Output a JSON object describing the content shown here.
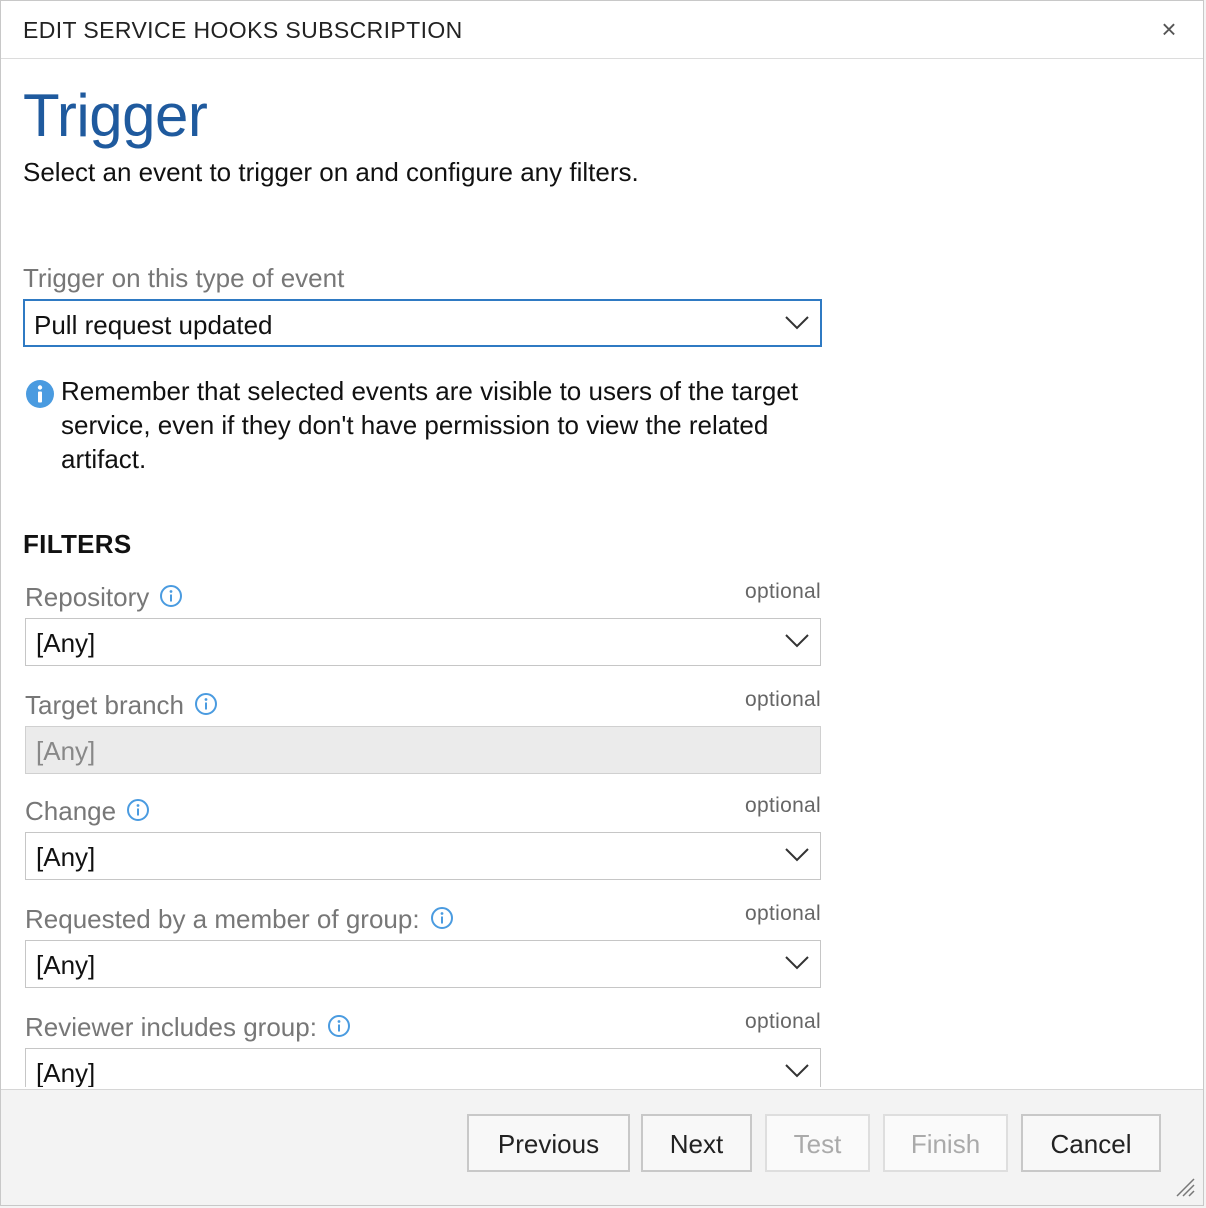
{
  "dialog": {
    "title": "EDIT SERVICE HOOKS SUBSCRIPTION",
    "close_icon": "close-icon"
  },
  "page": {
    "title": "Trigger",
    "subtitle": "Select an event to trigger on and configure any filters."
  },
  "event": {
    "label": "Trigger on this type of event",
    "selected": "Pull request updated"
  },
  "notice": {
    "icon": "info-icon",
    "text": "Remember that selected events are visible to users of the target service, even if they don't have permission to view the related artifact."
  },
  "filters": {
    "heading": "FILTERS",
    "optional_label": "optional",
    "items": [
      {
        "label": "Repository",
        "value": "[Any]",
        "disabled": false
      },
      {
        "label": "Target branch",
        "value": "[Any]",
        "disabled": true
      },
      {
        "label": "Change",
        "value": "[Any]",
        "disabled": false
      },
      {
        "label": "Requested by a member of group:",
        "value": "[Any]",
        "disabled": false
      },
      {
        "label": "Reviewer includes group:",
        "value": "[Any]",
        "disabled": false
      }
    ]
  },
  "footer": {
    "previous": "Previous",
    "next": "Next",
    "test": "Test",
    "finish": "Finish",
    "cancel": "Cancel"
  },
  "colors": {
    "accent": "#1f5a9e",
    "focus_border": "#2f7ac3",
    "info_icon": "#4a9be0"
  }
}
